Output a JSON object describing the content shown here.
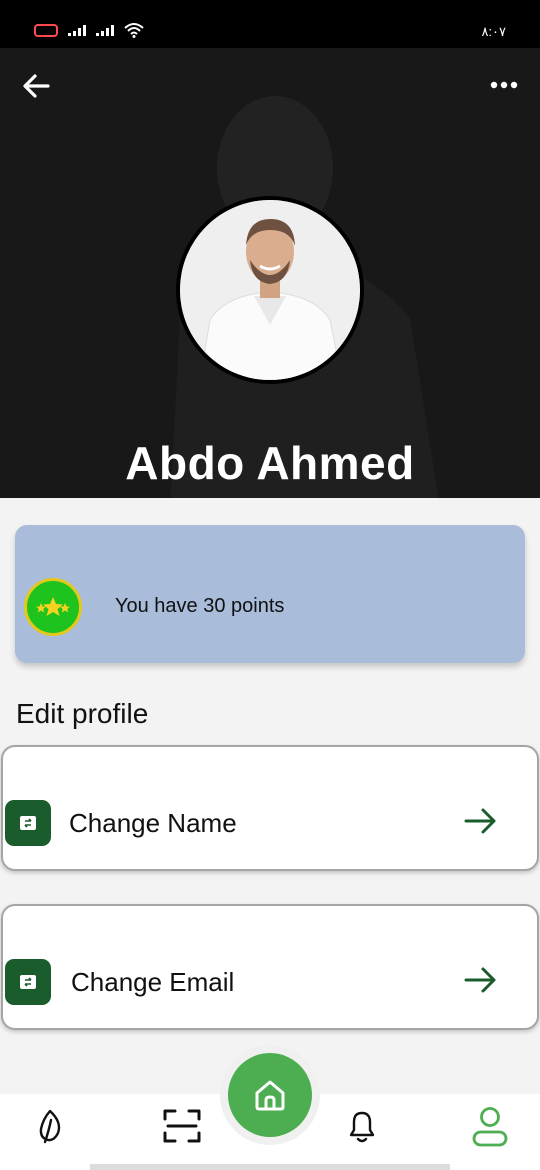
{
  "status_bar": {
    "time": "٨:٠٧",
    "battery_color": "#ff4b4b"
  },
  "header": {
    "back_icon": "arrow-left-icon",
    "more_icon": "more-horizontal-icon"
  },
  "profile": {
    "name": "Abdo Ahmed"
  },
  "points": {
    "text": "You have 30 points",
    "badge_icon": "stars-badge-icon",
    "card_color": "#a9bcda"
  },
  "edit_section": {
    "title": "Edit profile",
    "items": [
      {
        "label": "Change Name",
        "icon": "edit-card-icon",
        "arrow_icon": "arrow-right-icon"
      },
      {
        "label": "Change Email",
        "icon": "edit-card-icon",
        "arrow_icon": "arrow-right-icon"
      }
    ]
  },
  "bottom_nav": {
    "items": [
      {
        "icon": "leaf-icon"
      },
      {
        "icon": "scan-icon"
      },
      {
        "icon": "home-icon"
      },
      {
        "icon": "bell-icon"
      },
      {
        "icon": "profile-icon",
        "active": true
      }
    ],
    "accent": "#4cae50",
    "icon_dark": "#1b5c2d"
  }
}
